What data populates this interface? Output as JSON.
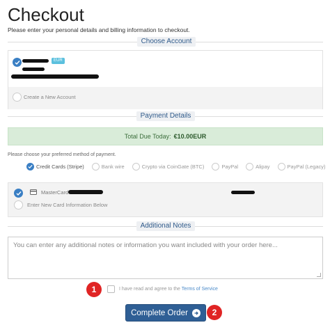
{
  "page": {
    "title": "Checkout",
    "subtitle": "Please enter your personal details and billing information to checkout."
  },
  "account": {
    "section_label": "Choose Account",
    "currency_badge": "EUR",
    "create_new_label": "Create a New Account"
  },
  "payment": {
    "section_label": "Payment Details",
    "total_label": "Total Due Today:",
    "total_value": "€10.00EUR",
    "method_prompt": "Please choose your preferred method of payment.",
    "methods": [
      {
        "label": "Credit Cards (Stripe)",
        "selected": true
      },
      {
        "label": "Bank wire",
        "selected": false
      },
      {
        "label": "Crypto via CoinGate (BTC)",
        "selected": false
      },
      {
        "label": "PayPal",
        "selected": false
      },
      {
        "label": "Alipay",
        "selected": false
      },
      {
        "label": "PayPal (Legacy)",
        "selected": false
      }
    ],
    "saved_card_label": "MasterCard",
    "new_card_label": "Enter New Card Information Below"
  },
  "notes": {
    "section_label": "Additional Notes",
    "placeholder": "You can enter any additional notes or information you want included with your order here..."
  },
  "terms": {
    "prefix": "I have read and agree to the",
    "link_label": "Terms of Service"
  },
  "actions": {
    "complete_label": "Complete Order"
  },
  "annotations": {
    "badge_1": "1",
    "badge_2": "2"
  },
  "colors": {
    "accent": "#3a7fc4",
    "button": "#2f5f95",
    "total_bg": "#d9ecd9",
    "badge_red": "#e02424"
  }
}
